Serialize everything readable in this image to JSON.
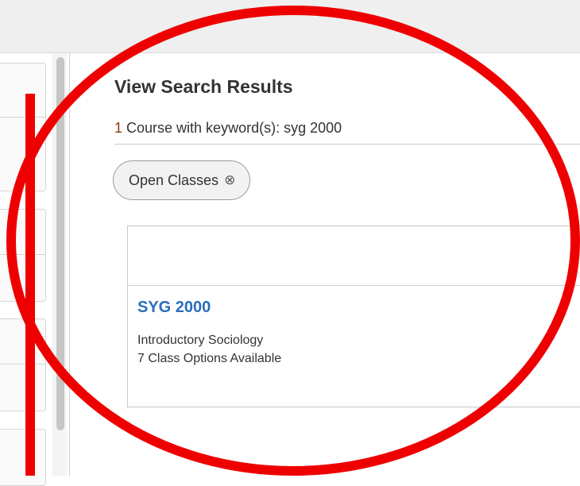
{
  "results": {
    "title": "View Search Results",
    "count": "1",
    "summary_text": " Course with keyword(s): syg 2000"
  },
  "filters": [
    {
      "label": "Open Classes",
      "close_glyph": "⊗"
    }
  ],
  "courses": [
    {
      "code": "SYG 2000",
      "title": "Introductory Sociology",
      "options": "7 Class Options Available"
    }
  ],
  "colors": {
    "accent_link": "#2a6ebb",
    "count_highlight": "#8a3a10",
    "annotation_red": "#ee0000"
  }
}
